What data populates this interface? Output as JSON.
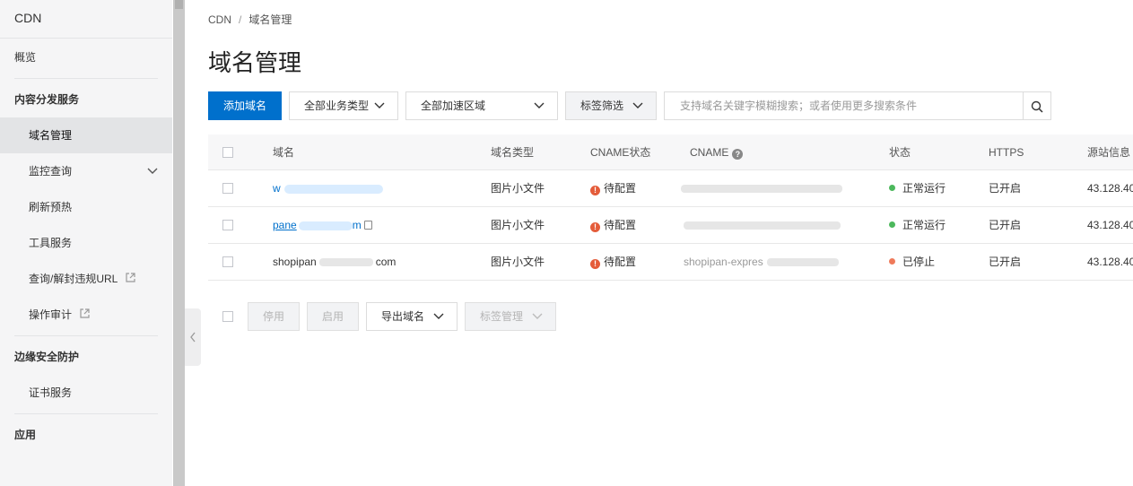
{
  "sidebar": {
    "title": "CDN",
    "overview": "概览",
    "section1": "内容分发服务",
    "items1": [
      "域名管理",
      "监控查询",
      "刷新预热",
      "工具服务",
      "查询/解封违规URL",
      "操作审计"
    ],
    "section2": "边缘安全防护",
    "items2": [
      "证书服务"
    ],
    "section3": "应用"
  },
  "breadcrumb": {
    "root": "CDN",
    "current": "域名管理"
  },
  "page_title": "域名管理",
  "toolbar": {
    "add_domain": "添加域名",
    "business_type": "全部业务类型",
    "accel_region": "全部加速区域",
    "tag_filter": "标签筛选",
    "search_placeholder": "支持域名关键字模糊搜索；或者使用更多搜索条件"
  },
  "table": {
    "headers": {
      "domain": "域名",
      "domain_type": "域名类型",
      "cname_status": "CNAME状态",
      "cname": "CNAME",
      "status": "状态",
      "https": "HTTPS",
      "origin": "源站信息"
    },
    "rows": [
      {
        "domain": "w",
        "domain_type": "图片小文件",
        "cname_status": "待配置",
        "status": "正常运行",
        "status_color": "#4cb85c",
        "https": "已开启",
        "origin": "43.128.40"
      },
      {
        "domain": "pane",
        "domain_suffix": "m",
        "domain_type": "图片小文件",
        "cname_status": "待配置",
        "status": "正常运行",
        "status_color": "#4cb85c",
        "https": "已开启",
        "origin": "43.128.40"
      },
      {
        "domain": "shopipan",
        "domain_suffix": "com",
        "cname_prefix": "shopipan-expres",
        "domain_type": "图片小文件",
        "cname_status": "待配置",
        "status": "已停止",
        "status_color": "#ef7a5a",
        "https": "已开启",
        "origin": "43.128.40"
      }
    ]
  },
  "actions": {
    "disable": "停用",
    "enable": "启用",
    "export_domain": "导出域名",
    "tag_manage": "标签管理"
  }
}
